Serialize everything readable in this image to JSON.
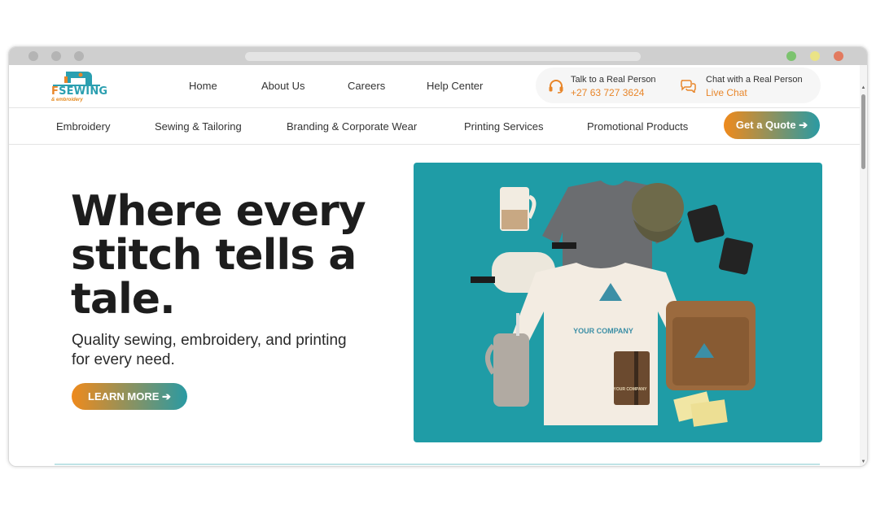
{
  "logo": {
    "prefix": "F",
    "name": "SEWING",
    "tagline": "& embroidery"
  },
  "top_nav": [
    {
      "label": "Home"
    },
    {
      "label": "About Us"
    },
    {
      "label": "Careers"
    },
    {
      "label": "Help Center"
    }
  ],
  "contact": {
    "phone_title": "Talk to a Real Person",
    "phone_number": "+27 63 727 3624",
    "chat_title": "Chat with a Real Person",
    "chat_link": "Live Chat"
  },
  "sub_nav": [
    {
      "label": "Embroidery"
    },
    {
      "label": "Sewing & Tailoring"
    },
    {
      "label": "Branding & Corporate Wear"
    },
    {
      "label": "Printing Services"
    },
    {
      "label": "Promotional Products"
    }
  ],
  "quote_button": "Get a Quote ➔",
  "hero": {
    "title": "Where every stitch tells a tale.",
    "subtitle": "Quality sewing, embroidery, and printing for every need.",
    "cta": "LEARN MORE ➔"
  },
  "product_image": {
    "brand_big": "YOUR COMPANY",
    "brand_small": "YOUR COMPANY"
  },
  "colors": {
    "accent_orange": "#ef8a1c",
    "accent_teal": "#2a9aa3",
    "hero_bg": "#1f9ca6"
  },
  "icons": {
    "phone": "headset-icon",
    "chat": "chat-bubbles-icon"
  }
}
